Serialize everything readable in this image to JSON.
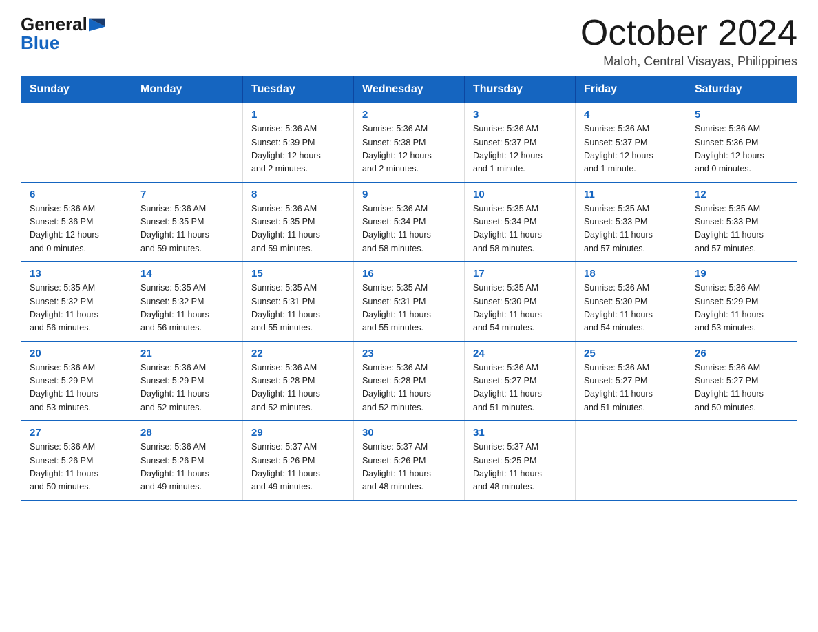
{
  "logo": {
    "general": "General",
    "blue": "Blue"
  },
  "header": {
    "title": "October 2024",
    "subtitle": "Maloh, Central Visayas, Philippines"
  },
  "weekdays": [
    "Sunday",
    "Monday",
    "Tuesday",
    "Wednesday",
    "Thursday",
    "Friday",
    "Saturday"
  ],
  "weeks": [
    [
      {
        "day": "",
        "info": ""
      },
      {
        "day": "",
        "info": ""
      },
      {
        "day": "1",
        "info": "Sunrise: 5:36 AM\nSunset: 5:39 PM\nDaylight: 12 hours\nand 2 minutes."
      },
      {
        "day": "2",
        "info": "Sunrise: 5:36 AM\nSunset: 5:38 PM\nDaylight: 12 hours\nand 2 minutes."
      },
      {
        "day": "3",
        "info": "Sunrise: 5:36 AM\nSunset: 5:37 PM\nDaylight: 12 hours\nand 1 minute."
      },
      {
        "day": "4",
        "info": "Sunrise: 5:36 AM\nSunset: 5:37 PM\nDaylight: 12 hours\nand 1 minute."
      },
      {
        "day": "5",
        "info": "Sunrise: 5:36 AM\nSunset: 5:36 PM\nDaylight: 12 hours\nand 0 minutes."
      }
    ],
    [
      {
        "day": "6",
        "info": "Sunrise: 5:36 AM\nSunset: 5:36 PM\nDaylight: 12 hours\nand 0 minutes."
      },
      {
        "day": "7",
        "info": "Sunrise: 5:36 AM\nSunset: 5:35 PM\nDaylight: 11 hours\nand 59 minutes."
      },
      {
        "day": "8",
        "info": "Sunrise: 5:36 AM\nSunset: 5:35 PM\nDaylight: 11 hours\nand 59 minutes."
      },
      {
        "day": "9",
        "info": "Sunrise: 5:36 AM\nSunset: 5:34 PM\nDaylight: 11 hours\nand 58 minutes."
      },
      {
        "day": "10",
        "info": "Sunrise: 5:35 AM\nSunset: 5:34 PM\nDaylight: 11 hours\nand 58 minutes."
      },
      {
        "day": "11",
        "info": "Sunrise: 5:35 AM\nSunset: 5:33 PM\nDaylight: 11 hours\nand 57 minutes."
      },
      {
        "day": "12",
        "info": "Sunrise: 5:35 AM\nSunset: 5:33 PM\nDaylight: 11 hours\nand 57 minutes."
      }
    ],
    [
      {
        "day": "13",
        "info": "Sunrise: 5:35 AM\nSunset: 5:32 PM\nDaylight: 11 hours\nand 56 minutes."
      },
      {
        "day": "14",
        "info": "Sunrise: 5:35 AM\nSunset: 5:32 PM\nDaylight: 11 hours\nand 56 minutes."
      },
      {
        "day": "15",
        "info": "Sunrise: 5:35 AM\nSunset: 5:31 PM\nDaylight: 11 hours\nand 55 minutes."
      },
      {
        "day": "16",
        "info": "Sunrise: 5:35 AM\nSunset: 5:31 PM\nDaylight: 11 hours\nand 55 minutes."
      },
      {
        "day": "17",
        "info": "Sunrise: 5:35 AM\nSunset: 5:30 PM\nDaylight: 11 hours\nand 54 minutes."
      },
      {
        "day": "18",
        "info": "Sunrise: 5:36 AM\nSunset: 5:30 PM\nDaylight: 11 hours\nand 54 minutes."
      },
      {
        "day": "19",
        "info": "Sunrise: 5:36 AM\nSunset: 5:29 PM\nDaylight: 11 hours\nand 53 minutes."
      }
    ],
    [
      {
        "day": "20",
        "info": "Sunrise: 5:36 AM\nSunset: 5:29 PM\nDaylight: 11 hours\nand 53 minutes."
      },
      {
        "day": "21",
        "info": "Sunrise: 5:36 AM\nSunset: 5:29 PM\nDaylight: 11 hours\nand 52 minutes."
      },
      {
        "day": "22",
        "info": "Sunrise: 5:36 AM\nSunset: 5:28 PM\nDaylight: 11 hours\nand 52 minutes."
      },
      {
        "day": "23",
        "info": "Sunrise: 5:36 AM\nSunset: 5:28 PM\nDaylight: 11 hours\nand 52 minutes."
      },
      {
        "day": "24",
        "info": "Sunrise: 5:36 AM\nSunset: 5:27 PM\nDaylight: 11 hours\nand 51 minutes."
      },
      {
        "day": "25",
        "info": "Sunrise: 5:36 AM\nSunset: 5:27 PM\nDaylight: 11 hours\nand 51 minutes."
      },
      {
        "day": "26",
        "info": "Sunrise: 5:36 AM\nSunset: 5:27 PM\nDaylight: 11 hours\nand 50 minutes."
      }
    ],
    [
      {
        "day": "27",
        "info": "Sunrise: 5:36 AM\nSunset: 5:26 PM\nDaylight: 11 hours\nand 50 minutes."
      },
      {
        "day": "28",
        "info": "Sunrise: 5:36 AM\nSunset: 5:26 PM\nDaylight: 11 hours\nand 49 minutes."
      },
      {
        "day": "29",
        "info": "Sunrise: 5:37 AM\nSunset: 5:26 PM\nDaylight: 11 hours\nand 49 minutes."
      },
      {
        "day": "30",
        "info": "Sunrise: 5:37 AM\nSunset: 5:26 PM\nDaylight: 11 hours\nand 48 minutes."
      },
      {
        "day": "31",
        "info": "Sunrise: 5:37 AM\nSunset: 5:25 PM\nDaylight: 11 hours\nand 48 minutes."
      },
      {
        "day": "",
        "info": ""
      },
      {
        "day": "",
        "info": ""
      }
    ]
  ]
}
